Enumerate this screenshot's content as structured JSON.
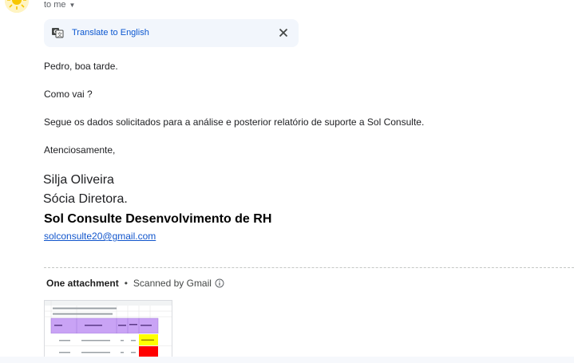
{
  "header": {
    "recipient": "to me",
    "avatar_icon": "sun-avatar"
  },
  "translate": {
    "link_label": "Translate to English",
    "icon": "translate-icon",
    "close_icon": "close-icon"
  },
  "message": {
    "greeting": "Pedro, boa tarde.",
    "question": "Como vai ?",
    "body": "Segue os dados solicitados para a análise e posterior relatório de suporte a Sol Consulte.",
    "closing": "Atenciosamente,"
  },
  "signature": {
    "name": "Silja Oliveira",
    "role": "Sócia Diretora.",
    "company": "Sol Consulte Desenvolvimento de RH",
    "email": "solconsulte20@gmail.com"
  },
  "attachments": {
    "title": "One attachment",
    "separator": "•",
    "scan_status": "Scanned by Gmail",
    "info_icon": "info-icon"
  },
  "colors": {
    "link": "#0b57d0",
    "translate_bg": "#f2f6fc",
    "header_purple": "#c9a3f5",
    "cell_yellow": "#ffff00",
    "cell_red": "#ff0000"
  }
}
